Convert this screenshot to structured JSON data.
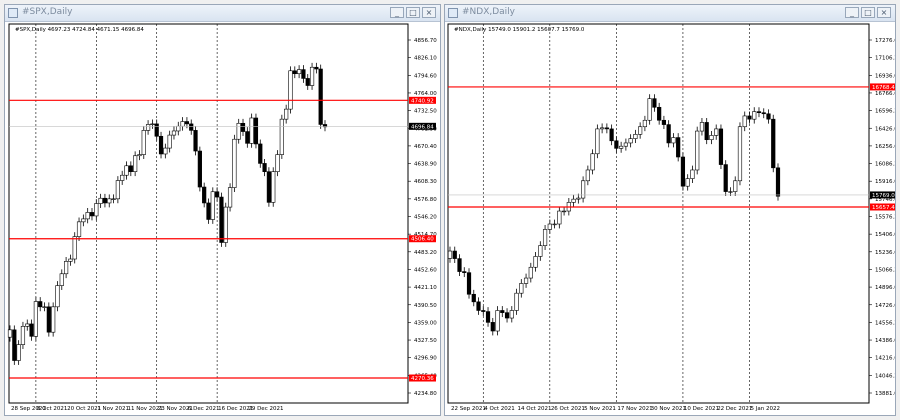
{
  "windows": [
    {
      "title": "#SPX,Daily",
      "caption": "#SPX,Daily  4697.23 4724.84 4671.15 4696.84",
      "yTicks": [
        "4856.70",
        "4826.10",
        "4794.60",
        "4764.00",
        "4732.50",
        "4701.90",
        "4670.40",
        "4638.90",
        "4608.30",
        "4576.80",
        "4546.20",
        "4514.70",
        "4483.20",
        "4452.60",
        "4421.10",
        "4390.50",
        "4359.00",
        "4327.50",
        "4296.90",
        "4265.40",
        "4234.80"
      ],
      "hlines": [
        {
          "label": "4740.92",
          "value": 4740.92
        },
        {
          "label": "4506.40",
          "value": 4506.4
        },
        {
          "label": "4270.36",
          "value": 4270.36
        }
      ],
      "current": {
        "label": "4696.84",
        "value": 4696.84
      },
      "xLabels": [
        "28 Sep 2021",
        "8 Oct 2021",
        "20 Oct 2021",
        "1 Nov 2021",
        "11 Nov 2021",
        "23 Nov 2021",
        "6 Dec 2021",
        "16 Dec 2021",
        "29 Dec 2021"
      ]
    },
    {
      "title": "#NDX,Daily",
      "caption": "#NDX,Daily  15749.0 15901.2 15607.7 15769.0",
      "yTicks": [
        "17276.6",
        "17106.3",
        "16936.0",
        "16766.6",
        "16596.3",
        "16426.0",
        "16256.6",
        "16086.3",
        "15916.0",
        "15746.6",
        "15576.3",
        "15406.0",
        "15236.6",
        "15066.3",
        "14896.0",
        "14726.6",
        "14556.3",
        "14386.0",
        "14216.6",
        "14046.3",
        "13881.0"
      ],
      "hlines": [
        {
          "label": "16768.4",
          "value": 16768.4
        },
        {
          "label": "15657.4",
          "value": 15657.4
        }
      ],
      "current": {
        "label": "15769.0",
        "value": 15769.0
      },
      "xLabels": [
        "22 Sep 2021",
        "4 Oct 2021",
        "14 Oct 2021",
        "26 Oct 2021",
        "5 Nov 2021",
        "17 Nov 2021",
        "30 Nov 2021",
        "10 Dec 2021",
        "22 Dec 2021",
        "5 Jan 2022"
      ]
    }
  ],
  "colors": {
    "bull": "#ffffff",
    "bear": "#000000",
    "level": "#ff0000",
    "grid": "#000000",
    "label_bg": "#ff0000"
  },
  "chart_data": [
    {
      "type": "candlestick",
      "title": "#SPX,Daily",
      "ylim": [
        4234.8,
        4856.7
      ],
      "x": [
        "28 Sep 2021",
        "8 Oct 2021",
        "20 Oct 2021",
        "1 Nov 2021",
        "11 Nov 2021",
        "23 Nov 2021",
        "6 Dec 2021",
        "16 Dec 2021",
        "29 Dec 2021"
      ],
      "close": [
        4352,
        4300,
        4327,
        4358,
        4362,
        4341,
        4400,
        4391,
        4391,
        4348,
        4391,
        4427,
        4447,
        4468,
        4472,
        4510,
        4535,
        4540,
        4551,
        4545,
        4566,
        4575,
        4567,
        4574,
        4574,
        4605,
        4614,
        4630,
        4620,
        4647,
        4649,
        4690,
        4700,
        4701,
        4680,
        4650,
        4660,
        4682,
        4689,
        4697,
        4705,
        4701,
        4690,
        4655,
        4594,
        4567,
        4539,
        4586,
        4577,
        4500,
        4560,
        4593,
        4675,
        4702,
        4688,
        4668,
        4711,
        4667,
        4634,
        4620,
        4568,
        4620,
        4649,
        4709,
        4726,
        4791,
        4786,
        4793,
        4778,
        4766,
        4797,
        4794,
        4700,
        4696
      ]
    },
    {
      "type": "candlestick",
      "title": "#NDX,Daily",
      "ylim": [
        13881.0,
        17276.6
      ],
      "x": [
        "22 Sep 2021",
        "4 Oct 2021",
        "14 Oct 2021",
        "26 Oct 2021",
        "5 Nov 2021",
        "17 Nov 2021",
        "30 Nov 2021",
        "10 Dec 2021",
        "22 Dec 2021",
        "5 Jan 2022"
      ],
      "close": [
        15250,
        15180,
        15060,
        15050,
        14850,
        14780,
        14700,
        14690,
        14590,
        14510,
        14700,
        14680,
        14630,
        14700,
        14860,
        14950,
        15000,
        15100,
        15200,
        15300,
        15450,
        15500,
        15500,
        15620,
        15620,
        15700,
        15730,
        15740,
        15900,
        16000,
        16150,
        16380,
        16390,
        16380,
        16270,
        16200,
        16220,
        16250,
        16290,
        16330,
        16400,
        16460,
        16660,
        16580,
        16460,
        16420,
        16250,
        16300,
        16120,
        15850,
        15920,
        16000,
        16360,
        16440,
        16280,
        16320,
        16380,
        16050,
        15800,
        15800,
        15900,
        16400,
        16500,
        16470,
        16540,
        16530,
        16520,
        16470,
        16020,
        15757
      ]
    }
  ]
}
